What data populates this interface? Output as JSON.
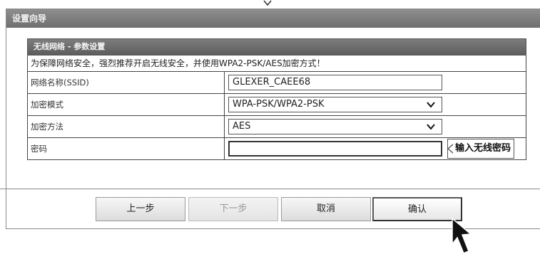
{
  "wizard": {
    "title": "设置向导"
  },
  "section": {
    "header": "无线网络 - 参数设置",
    "notice": "为保障网络安全，强烈推荐开启无线安全，并使用WPA2-PSK/AES加密方式！",
    "rows": [
      {
        "label": "网络名称(SSID)",
        "value": "GLEXER_CAEE68"
      },
      {
        "label": "加密模式",
        "value": "WPA-PSK/WPA2-PSK"
      },
      {
        "label": "加密方法",
        "value": "AES"
      },
      {
        "label": "密码",
        "value": "",
        "hint": "输入无线密码"
      }
    ]
  },
  "buttons": {
    "prev": "上一步",
    "next": "下一步",
    "cancel": "取消",
    "confirm": "确认"
  },
  "icons": {
    "chevron": "chevron-down-icon",
    "select_arrow": "chevron-down-icon",
    "pointer": "arrow-cursor-icon"
  },
  "colors": {
    "title_bar": "#7a7a7a",
    "section_header": "#6a6a6a",
    "border": "#444444"
  }
}
